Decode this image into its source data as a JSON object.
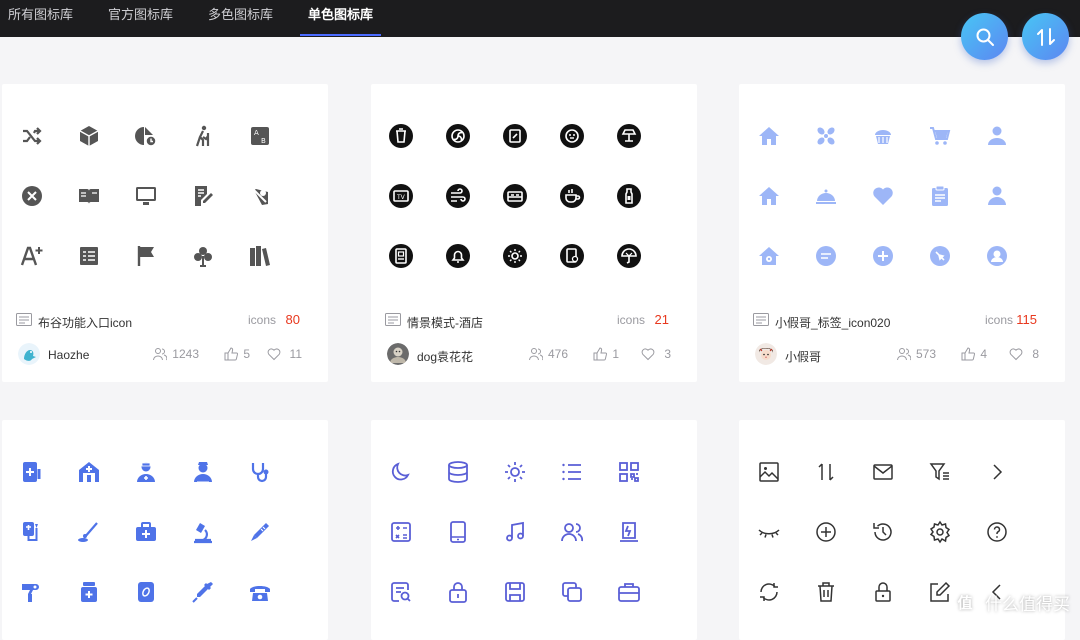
{
  "nav": {
    "tabs": [
      "所有图标库",
      "官方图标库",
      "多色图标库",
      "单色图标库"
    ],
    "active_index": 3
  },
  "fab": {
    "search_icon": "search-icon",
    "sort_icon": "sort-icon"
  },
  "colors": {
    "gray": "#555555",
    "black": "#111111",
    "light_blue": "#9db6f7",
    "blue": "#4f73e8",
    "indigo": "#5a5fd6",
    "dark": "#333333",
    "count_red": "#e8381e",
    "accent": "#4b6bff"
  },
  "cards": [
    {
      "name": "布谷功能入口icon",
      "icons_label": "icons",
      "count": "80",
      "user": "Haozhe",
      "views": "1243",
      "likes": "5",
      "favorites": "11",
      "style": "gray",
      "icons": [
        "shuffle-icon",
        "cube-icon",
        "pie-clock-icon",
        "hiking-icon",
        "ab-test-icon",
        "close-circle-icon",
        "book-open-icon",
        "monitor-icon",
        "edit-note-icon",
        "location-off-icon",
        "font-plus-icon",
        "list-box-icon",
        "flag-icon",
        "club-icon",
        "books-icon"
      ]
    },
    {
      "name": "情景模式-酒店",
      "icons_label": "icons",
      "count": "21",
      "user": "dog袁花花",
      "views": "476",
      "likes": "1",
      "favorites": "3",
      "style": "black-circle",
      "icons": [
        "trash-bin-icon",
        "fan-icon",
        "frame-icon",
        "dial-icon",
        "lamp-icon",
        "tv-icon",
        "wind-icon",
        "bed-icon",
        "coffee-icon",
        "bottle-icon",
        "phone-card-icon",
        "bell-icon",
        "sun-icon",
        "card-lock-icon",
        "umbrella-icon"
      ]
    },
    {
      "name": "小假哥_标签_icon020",
      "icons_label": "icons",
      "count": "115",
      "user": "小假哥",
      "views": "573",
      "likes": "4",
      "favorites": "8",
      "style": "light-blue",
      "icons": [
        "home-icon",
        "pinwheel-icon",
        "cupcake-icon",
        "cart-icon",
        "user-icon",
        "house-icon",
        "cloche-icon",
        "heart-icon",
        "clipboard-icon",
        "person-icon",
        "home-outline-icon",
        "chat-bubble-icon",
        "plus-circle-icon",
        "compass-icon",
        "avatar-circle-icon"
      ]
    },
    {
      "name": "",
      "style": "blue",
      "icons": [
        "medical-doc-icon",
        "hospital-icon",
        "doctor-icon",
        "nurse-icon",
        "stethoscope-icon",
        "iv-drip-icon",
        "swab-icon",
        "first-aid-kit-icon",
        "microscope-icon",
        "thermometer-icon",
        "thermo-gun-icon",
        "pill-bottle-icon",
        "capsule-pack-icon",
        "syringe-icon",
        "phone-icon"
      ]
    },
    {
      "name": "",
      "style": "indigo",
      "icons": [
        "moon-icon",
        "database-icon",
        "sun-outline-icon",
        "list-icon",
        "qr-code-icon",
        "calculator-icon",
        "tablet-icon",
        "music-icon",
        "users-icon",
        "power-icon",
        "search-doc-icon",
        "lock-icon",
        "save-icon",
        "copy-icon",
        "briefcase-icon"
      ]
    },
    {
      "name": "",
      "style": "dark",
      "icons": [
        "image-icon",
        "sort-arrows-icon",
        "mail-icon",
        "filter-list-icon",
        "chevron-right-icon",
        "eye-closed-icon",
        "plus-circle-outline-icon",
        "history-icon",
        "settings-icon",
        "help-icon",
        "refresh-icon",
        "delete-icon",
        "padlock-icon",
        "edit-box-icon",
        "chevron-left-icon"
      ]
    }
  ],
  "watermark": {
    "logo": "值",
    "text": "什么值得买"
  }
}
